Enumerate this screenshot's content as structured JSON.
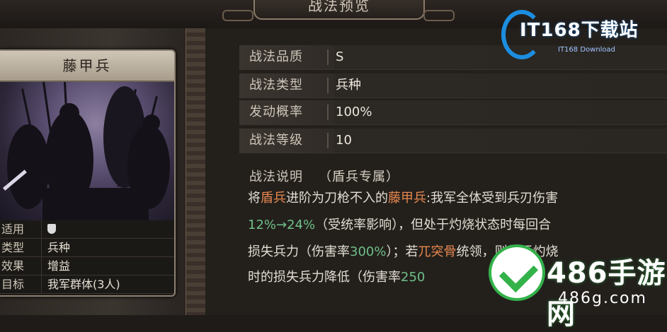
{
  "header": {
    "title": "战法预览"
  },
  "card": {
    "name": "藤甲兵",
    "rows": [
      {
        "key": "适用",
        "value": ""
      },
      {
        "key": "类型",
        "value": "兵种"
      },
      {
        "key": "效果",
        "value": "增益"
      },
      {
        "key": "目标",
        "value": "我军群体(3人)"
      }
    ]
  },
  "attributes": [
    {
      "key": "战法品质",
      "value": "S"
    },
    {
      "key": "战法类型",
      "value": "兵种"
    },
    {
      "key": "发动概率",
      "value": "100%"
    },
    {
      "key": "战法等级",
      "value": "10"
    }
  ],
  "description": {
    "heading": "战法说明",
    "tag": "（盾兵专属）",
    "line1": [
      {
        "t": "将",
        "c": "plain"
      },
      {
        "t": "盾兵",
        "c": "orange"
      },
      {
        "t": "进阶为刀枪不入的",
        "c": "plain"
      },
      {
        "t": "藤甲兵",
        "c": "orange"
      },
      {
        "t": ":我军全体受到兵刃伤害",
        "c": "plain"
      }
    ],
    "line2": [
      {
        "t": "12%→24%",
        "c": "green"
      },
      {
        "t": "（受统率影响），但处于灼烧状态时每回合",
        "c": "plain"
      }
    ],
    "line3": [
      {
        "t": "损失兵力（伤害率",
        "c": "plain"
      },
      {
        "t": "300%",
        "c": "green"
      },
      {
        "t": "）；若",
        "c": "plain"
      },
      {
        "t": "兀突骨",
        "c": "orange"
      },
      {
        "t": "统领，则处于灼烧",
        "c": "plain"
      }
    ],
    "line4": [
      {
        "t": "时的损失兵力降低（伤害率",
        "c": "plain"
      },
      {
        "t": "250",
        "c": "green"
      }
    ]
  },
  "watermarks": {
    "top_brand": "IT168下载站",
    "top_sub": "IT168 Download",
    "bottom_brand": "486手游网",
    "bottom_url": "486g.com"
  }
}
